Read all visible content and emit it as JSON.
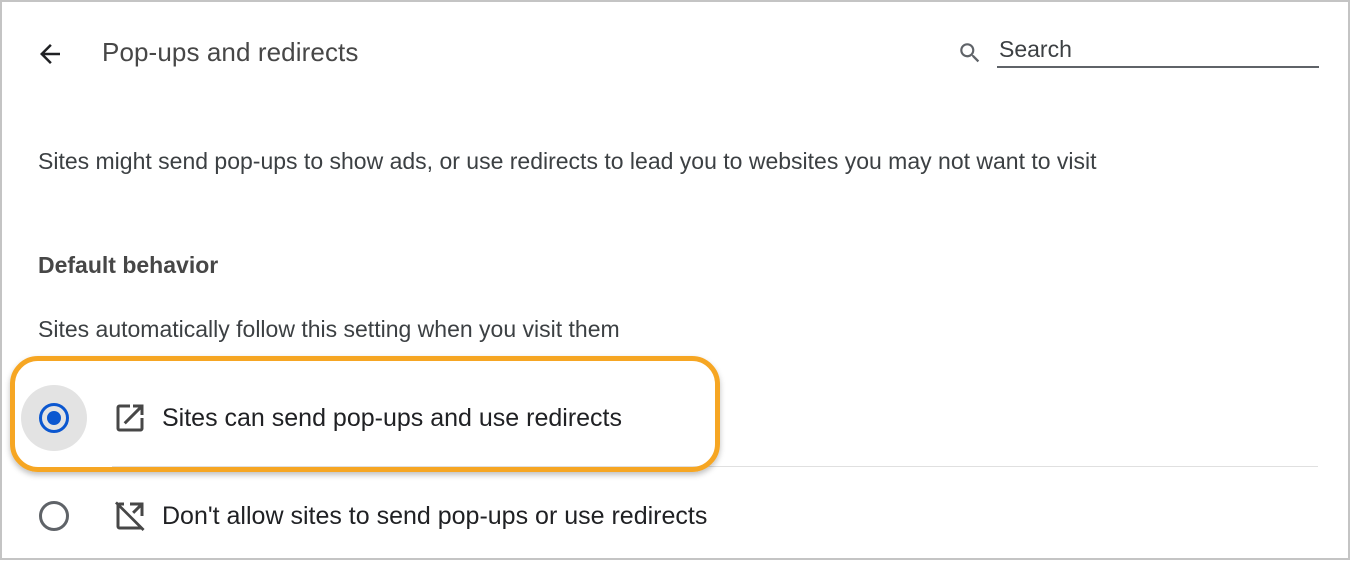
{
  "header": {
    "back_icon": "arrow-back-icon",
    "title": "Pop-ups and redirects",
    "search": {
      "icon": "search-icon",
      "placeholder": "Search",
      "value": ""
    }
  },
  "description": "Sites might send pop-ups to show ads, or use redirects to lead you to websites you may not want to visit",
  "default_behavior": {
    "title": "Default behavior",
    "subtitle": "Sites automatically follow this setting when you visit them",
    "options": [
      {
        "label": "Sites can send pop-ups and use redirects",
        "icon": "open-in-new-icon",
        "selected": true
      },
      {
        "label": "Don't allow sites to send pop-ups or use redirects",
        "icon": "open-in-new-off-icon",
        "selected": false
      }
    ]
  },
  "colors": {
    "accent": "#0b57d0",
    "highlight": "#f6a623"
  }
}
